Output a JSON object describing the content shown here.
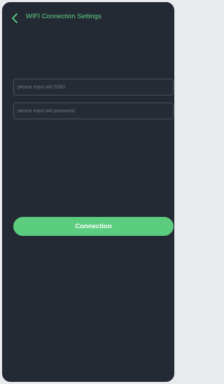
{
  "header": {
    "title": "WIFI Connection Settings",
    "back_icon": "chevron-left-icon"
  },
  "form": {
    "ssid": {
      "value": "",
      "placeholder": "please input wifi SSID"
    },
    "password": {
      "value": "",
      "placeholder": "please input wifi password"
    },
    "connect_label": "Connection"
  },
  "colors": {
    "background": "#242a33",
    "accent": "#5ccd7f",
    "field_border": "#4b525c",
    "placeholder": "#6f7782"
  }
}
